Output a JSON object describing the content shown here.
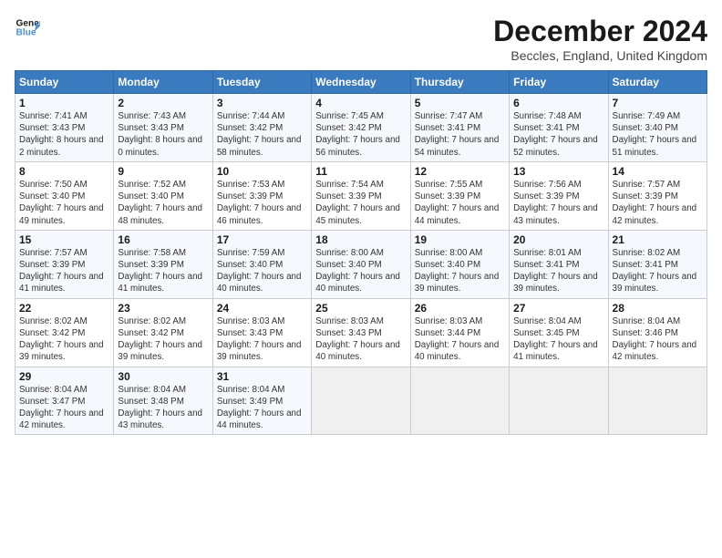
{
  "header": {
    "title": "December 2024",
    "location": "Beccles, England, United Kingdom"
  },
  "columns": [
    "Sunday",
    "Monday",
    "Tuesday",
    "Wednesday",
    "Thursday",
    "Friday",
    "Saturday"
  ],
  "weeks": [
    [
      {
        "day": "1",
        "sunrise": "Sunrise: 7:41 AM",
        "sunset": "Sunset: 3:43 PM",
        "daylight": "Daylight: 8 hours and 2 minutes."
      },
      {
        "day": "2",
        "sunrise": "Sunrise: 7:43 AM",
        "sunset": "Sunset: 3:43 PM",
        "daylight": "Daylight: 8 hours and 0 minutes."
      },
      {
        "day": "3",
        "sunrise": "Sunrise: 7:44 AM",
        "sunset": "Sunset: 3:42 PM",
        "daylight": "Daylight: 7 hours and 58 minutes."
      },
      {
        "day": "4",
        "sunrise": "Sunrise: 7:45 AM",
        "sunset": "Sunset: 3:42 PM",
        "daylight": "Daylight: 7 hours and 56 minutes."
      },
      {
        "day": "5",
        "sunrise": "Sunrise: 7:47 AM",
        "sunset": "Sunset: 3:41 PM",
        "daylight": "Daylight: 7 hours and 54 minutes."
      },
      {
        "day": "6",
        "sunrise": "Sunrise: 7:48 AM",
        "sunset": "Sunset: 3:41 PM",
        "daylight": "Daylight: 7 hours and 52 minutes."
      },
      {
        "day": "7",
        "sunrise": "Sunrise: 7:49 AM",
        "sunset": "Sunset: 3:40 PM",
        "daylight": "Daylight: 7 hours and 51 minutes."
      }
    ],
    [
      {
        "day": "8",
        "sunrise": "Sunrise: 7:50 AM",
        "sunset": "Sunset: 3:40 PM",
        "daylight": "Daylight: 7 hours and 49 minutes."
      },
      {
        "day": "9",
        "sunrise": "Sunrise: 7:52 AM",
        "sunset": "Sunset: 3:40 PM",
        "daylight": "Daylight: 7 hours and 48 minutes."
      },
      {
        "day": "10",
        "sunrise": "Sunrise: 7:53 AM",
        "sunset": "Sunset: 3:39 PM",
        "daylight": "Daylight: 7 hours and 46 minutes."
      },
      {
        "day": "11",
        "sunrise": "Sunrise: 7:54 AM",
        "sunset": "Sunset: 3:39 PM",
        "daylight": "Daylight: 7 hours and 45 minutes."
      },
      {
        "day": "12",
        "sunrise": "Sunrise: 7:55 AM",
        "sunset": "Sunset: 3:39 PM",
        "daylight": "Daylight: 7 hours and 44 minutes."
      },
      {
        "day": "13",
        "sunrise": "Sunrise: 7:56 AM",
        "sunset": "Sunset: 3:39 PM",
        "daylight": "Daylight: 7 hours and 43 minutes."
      },
      {
        "day": "14",
        "sunrise": "Sunrise: 7:57 AM",
        "sunset": "Sunset: 3:39 PM",
        "daylight": "Daylight: 7 hours and 42 minutes."
      }
    ],
    [
      {
        "day": "15",
        "sunrise": "Sunrise: 7:57 AM",
        "sunset": "Sunset: 3:39 PM",
        "daylight": "Daylight: 7 hours and 41 minutes."
      },
      {
        "day": "16",
        "sunrise": "Sunrise: 7:58 AM",
        "sunset": "Sunset: 3:39 PM",
        "daylight": "Daylight: 7 hours and 41 minutes."
      },
      {
        "day": "17",
        "sunrise": "Sunrise: 7:59 AM",
        "sunset": "Sunset: 3:40 PM",
        "daylight": "Daylight: 7 hours and 40 minutes."
      },
      {
        "day": "18",
        "sunrise": "Sunrise: 8:00 AM",
        "sunset": "Sunset: 3:40 PM",
        "daylight": "Daylight: 7 hours and 40 minutes."
      },
      {
        "day": "19",
        "sunrise": "Sunrise: 8:00 AM",
        "sunset": "Sunset: 3:40 PM",
        "daylight": "Daylight: 7 hours and 39 minutes."
      },
      {
        "day": "20",
        "sunrise": "Sunrise: 8:01 AM",
        "sunset": "Sunset: 3:41 PM",
        "daylight": "Daylight: 7 hours and 39 minutes."
      },
      {
        "day": "21",
        "sunrise": "Sunrise: 8:02 AM",
        "sunset": "Sunset: 3:41 PM",
        "daylight": "Daylight: 7 hours and 39 minutes."
      }
    ],
    [
      {
        "day": "22",
        "sunrise": "Sunrise: 8:02 AM",
        "sunset": "Sunset: 3:42 PM",
        "daylight": "Daylight: 7 hours and 39 minutes."
      },
      {
        "day": "23",
        "sunrise": "Sunrise: 8:02 AM",
        "sunset": "Sunset: 3:42 PM",
        "daylight": "Daylight: 7 hours and 39 minutes."
      },
      {
        "day": "24",
        "sunrise": "Sunrise: 8:03 AM",
        "sunset": "Sunset: 3:43 PM",
        "daylight": "Daylight: 7 hours and 39 minutes."
      },
      {
        "day": "25",
        "sunrise": "Sunrise: 8:03 AM",
        "sunset": "Sunset: 3:43 PM",
        "daylight": "Daylight: 7 hours and 40 minutes."
      },
      {
        "day": "26",
        "sunrise": "Sunrise: 8:03 AM",
        "sunset": "Sunset: 3:44 PM",
        "daylight": "Daylight: 7 hours and 40 minutes."
      },
      {
        "day": "27",
        "sunrise": "Sunrise: 8:04 AM",
        "sunset": "Sunset: 3:45 PM",
        "daylight": "Daylight: 7 hours and 41 minutes."
      },
      {
        "day": "28",
        "sunrise": "Sunrise: 8:04 AM",
        "sunset": "Sunset: 3:46 PM",
        "daylight": "Daylight: 7 hours and 42 minutes."
      }
    ],
    [
      {
        "day": "29",
        "sunrise": "Sunrise: 8:04 AM",
        "sunset": "Sunset: 3:47 PM",
        "daylight": "Daylight: 7 hours and 42 minutes."
      },
      {
        "day": "30",
        "sunrise": "Sunrise: 8:04 AM",
        "sunset": "Sunset: 3:48 PM",
        "daylight": "Daylight: 7 hours and 43 minutes."
      },
      {
        "day": "31",
        "sunrise": "Sunrise: 8:04 AM",
        "sunset": "Sunset: 3:49 PM",
        "daylight": "Daylight: 7 hours and 44 minutes."
      },
      null,
      null,
      null,
      null
    ]
  ]
}
